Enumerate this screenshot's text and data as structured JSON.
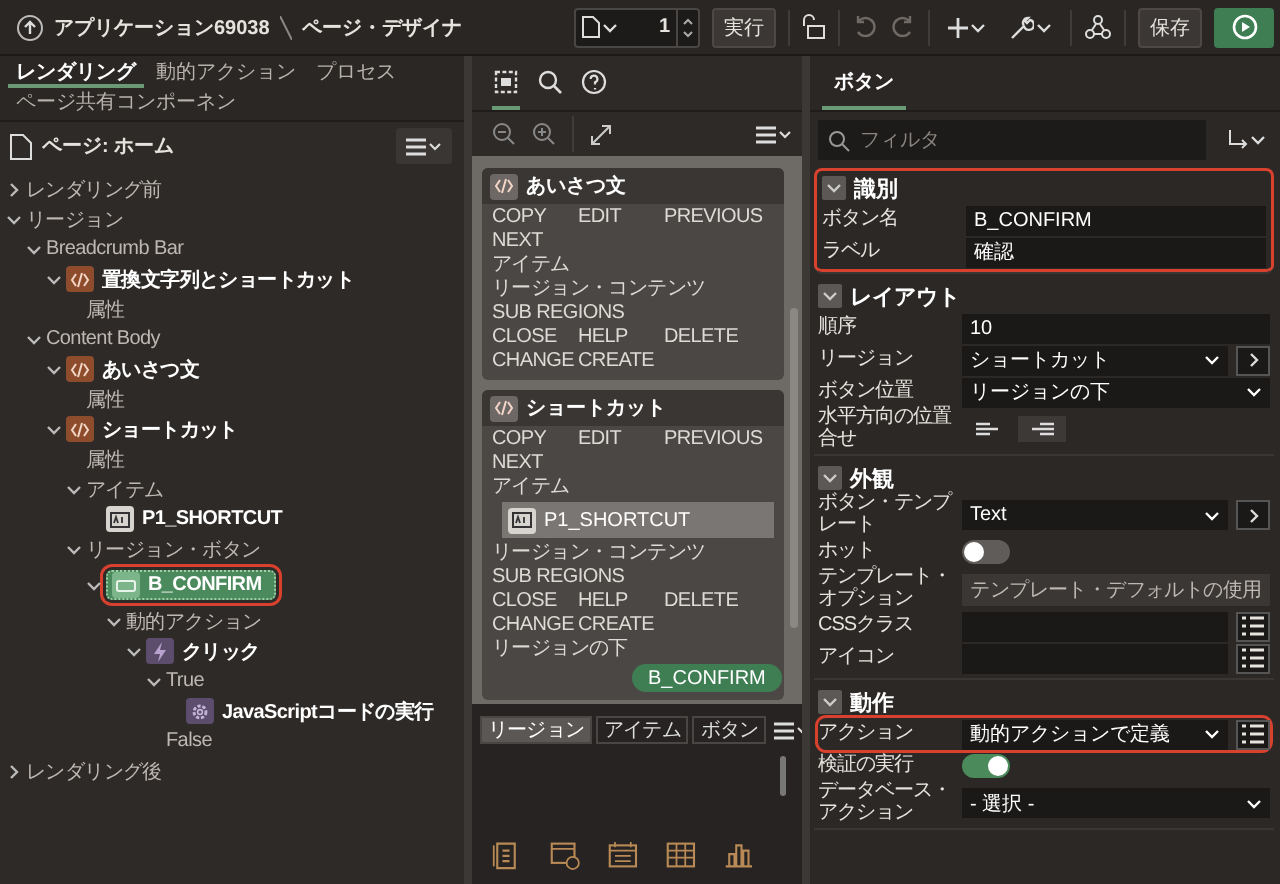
{
  "header": {
    "app_name": "アプリケーション69038",
    "page": "ページ・デザイナ"
  },
  "toolbar": {
    "page_number": "1",
    "run": "実行",
    "save": "保存"
  },
  "left": {
    "tabs": [
      {
        "label": "レンダリング",
        "selected": true
      },
      {
        "label": "動的アクション",
        "selected": false
      },
      {
        "label": "プロセス",
        "selected": false
      },
      {
        "label": "ページ共有コンポーネン",
        "selected": false
      }
    ],
    "page_label": "ページ: ホーム",
    "tree": [
      {
        "label": "レンダリング前",
        "expanded": false,
        "selected": false
      },
      {
        "label": "リージョン",
        "expanded": true,
        "selected": false,
        "children": [
          {
            "label": "Breadcrumb Bar",
            "expanded": true,
            "selected": false,
            "children": [
              {
                "label": "置換文字列とショートカット",
                "kind": "region",
                "expanded": true,
                "selected": false,
                "children": [
                  {
                    "label": "属性",
                    "selected": false
                  }
                ]
              }
            ]
          },
          {
            "label": "Content Body",
            "expanded": true,
            "selected": false,
            "children": [
              {
                "label": "あいさつ文",
                "kind": "region",
                "expanded": true,
                "selected": false,
                "children": [
                  {
                    "label": "属性",
                    "selected": false
                  }
                ]
              },
              {
                "label": "ショートカット",
                "kind": "region",
                "expanded": true,
                "selected": false,
                "children": [
                  {
                    "label": "属性",
                    "selected": false
                  },
                  {
                    "label": "アイテム",
                    "expanded": true,
                    "selected": false,
                    "children": [
                      {
                        "label": "P1_SHORTCUT",
                        "kind": "item",
                        "selected": false
                      }
                    ]
                  },
                  {
                    "label": "リージョン・ボタン",
                    "expanded": true,
                    "selected": false,
                    "children": [
                      {
                        "label": "B_CONFIRM",
                        "kind": "button",
                        "expanded": true,
                        "selected": true,
                        "highlighted": true,
                        "children": [
                          {
                            "label": "動的アクション",
                            "expanded": true,
                            "selected": false,
                            "children": [
                              {
                                "label": "クリック",
                                "kind": "event",
                                "expanded": true,
                                "selected": false,
                                "children": [
                                  {
                                    "label": "True",
                                    "expanded": true,
                                    "selected": false,
                                    "children": [
                                      {
                                        "label": "JavaScriptコードの実行",
                                        "kind": "action",
                                        "selected": false
                                      }
                                    ]
                                  },
                                  {
                                    "label": "False",
                                    "selected": false
                                  }
                                ]
                              }
                            ]
                          }
                        ]
                      }
                    ]
                  }
                ]
              }
            ]
          }
        ]
      },
      {
        "label": "レンダリング後",
        "expanded": false,
        "selected": false
      }
    ]
  },
  "middle": {
    "tools": [
      {
        "kind": "layout",
        "selected": true
      },
      {
        "kind": "search",
        "selected": false
      },
      {
        "kind": "help",
        "selected": false
      }
    ],
    "regions": [
      {
        "title": "あいさつ文",
        "rows": [
          {
            "kind": "slots",
            "labels": [
              "COPY",
              "EDIT",
              "PREVIOUS"
            ]
          },
          {
            "kind": "slots",
            "labels": [
              "NEXT"
            ]
          },
          {
            "kind": "slots",
            "labels": [
              "アイテム"
            ]
          },
          {
            "kind": "slots",
            "labels": [
              "リージョン・コンテンツ"
            ]
          },
          {
            "kind": "slots",
            "labels": [
              "SUB REGIONS"
            ]
          },
          {
            "kind": "slots",
            "labels": [
              "CLOSE",
              "HELP",
              "DELETE"
            ]
          },
          {
            "kind": "slots",
            "labels": [
              "CHANGE",
              "CREATE"
            ]
          }
        ]
      },
      {
        "title": "ショートカット",
        "rows": [
          {
            "kind": "slots",
            "labels": [
              "COPY",
              "EDIT",
              "PREVIOUS"
            ]
          },
          {
            "kind": "slots",
            "labels": [
              "NEXT"
            ]
          },
          {
            "kind": "slots",
            "labels": [
              "アイテム"
            ]
          },
          {
            "kind": "item",
            "label": "P1_SHORTCUT"
          },
          {
            "kind": "slots",
            "labels": [
              "リージョン・コンテンツ"
            ]
          },
          {
            "kind": "slots",
            "labels": [
              "SUB REGIONS"
            ]
          },
          {
            "kind": "slots",
            "labels": [
              "CLOSE",
              "HELP",
              "DELETE"
            ]
          },
          {
            "kind": "slots",
            "labels": [
              "CHANGE",
              "CREATE"
            ]
          },
          {
            "kind": "slots",
            "labels": [
              "リージョンの下"
            ]
          },
          {
            "kind": "button",
            "label": "B_CONFIRM"
          }
        ]
      }
    ],
    "gallery_tabs": [
      {
        "label": "リージョン",
        "selected": true
      },
      {
        "label": "アイテム",
        "selected": false
      },
      {
        "label": "ボタン",
        "selected": false
      }
    ]
  },
  "right": {
    "tabs": [
      {
        "label": "ボタン",
        "selected": true
      }
    ],
    "filter": {
      "placeholder": "フィルタ"
    },
    "sections": [
      {
        "title": "識別",
        "expanded": true,
        "highlighted": true,
        "props": [
          {
            "label": "ボタン名",
            "kind": "text",
            "value": "B_CONFIRM"
          },
          {
            "label": "ラベル",
            "kind": "text",
            "value": "確認"
          }
        ]
      },
      {
        "title": "レイアウト",
        "expanded": true,
        "highlighted": false,
        "props": [
          {
            "label": "順序",
            "kind": "text",
            "value": "10"
          },
          {
            "label": "リージョン",
            "kind": "select",
            "value": "ショートカット",
            "side": {
              "kind": "goto"
            }
          },
          {
            "label": "ボタン位置",
            "kind": "select",
            "value": "リージョンの下"
          },
          {
            "label": "水平方向の位置合せ",
            "kind": "align",
            "options": [
              {
                "kind": "left",
                "selected": false
              },
              {
                "kind": "right",
                "selected": true
              }
            ]
          }
        ]
      },
      {
        "title": "外観",
        "expanded": true,
        "highlighted": false,
        "props": [
          {
            "label": "ボタン・テンプレート",
            "kind": "select",
            "value": "Text",
            "side": {
              "kind": "goto"
            }
          },
          {
            "label": "ホット",
            "kind": "switch",
            "on": false
          },
          {
            "label": "テンプレート・オプション",
            "kind": "button",
            "value": "テンプレート・デフォルトの使用"
          },
          {
            "label": "CSSクラス",
            "kind": "text",
            "side": {
              "kind": "list"
            }
          },
          {
            "label": "アイコン",
            "kind": "text",
            "side": {
              "kind": "list"
            }
          }
        ]
      },
      {
        "title": "動作",
        "expanded": true,
        "highlighted": false,
        "props": [
          {
            "label": "アクション",
            "kind": "select",
            "value": "動的アクションで定義",
            "side": {
              "kind": "list"
            },
            "highlighted": true
          },
          {
            "label": "検証の実行",
            "kind": "switch",
            "on": true
          },
          {
            "label": "データベース・アクション",
            "kind": "select",
            "value": "- 選択 -"
          }
        ]
      }
    ]
  }
}
